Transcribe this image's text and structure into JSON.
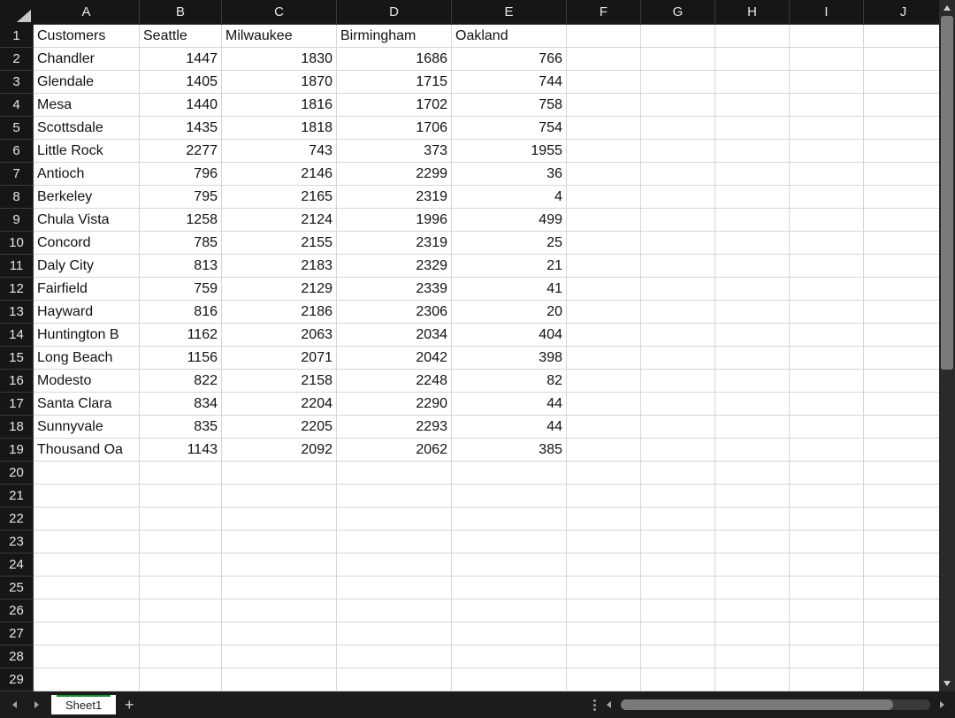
{
  "columns": [
    {
      "letter": "A",
      "width": 120
    },
    {
      "letter": "B",
      "width": 93
    },
    {
      "letter": "C",
      "width": 130
    },
    {
      "letter": "D",
      "width": 130
    },
    {
      "letter": "E",
      "width": 130
    },
    {
      "letter": "F",
      "width": 84
    },
    {
      "letter": "G",
      "width": 84
    },
    {
      "letter": "H",
      "width": 84
    },
    {
      "letter": "I",
      "width": 84
    },
    {
      "letter": "J",
      "width": 90
    }
  ],
  "row_count": 29,
  "headers": [
    "Customers",
    "Seattle",
    "Milwaukee",
    "Birmingham",
    "Oakland"
  ],
  "rows": [
    {
      "label": "Chandler",
      "v": [
        1447,
        1830,
        1686,
        766
      ]
    },
    {
      "label": "Glendale",
      "v": [
        1405,
        1870,
        1715,
        744
      ]
    },
    {
      "label": "Mesa",
      "v": [
        1440,
        1816,
        1702,
        758
      ]
    },
    {
      "label": "Scottsdale",
      "v": [
        1435,
        1818,
        1706,
        754
      ]
    },
    {
      "label": "Little Rock",
      "v": [
        2277,
        743,
        373,
        1955
      ]
    },
    {
      "label": "Antioch",
      "v": [
        796,
        2146,
        2299,
        36
      ]
    },
    {
      "label": "Berkeley",
      "v": [
        795,
        2165,
        2319,
        4
      ]
    },
    {
      "label": "Chula Vista",
      "v": [
        1258,
        2124,
        1996,
        499
      ]
    },
    {
      "label": "Concord",
      "v": [
        785,
        2155,
        2319,
        25
      ]
    },
    {
      "label": "Daly City",
      "v": [
        813,
        2183,
        2329,
        21
      ]
    },
    {
      "label": "Fairfield",
      "v": [
        759,
        2129,
        2339,
        41
      ]
    },
    {
      "label": "Hayward",
      "v": [
        816,
        2186,
        2306,
        20
      ]
    },
    {
      "label": "Huntington B",
      "v": [
        1162,
        2063,
        2034,
        404
      ]
    },
    {
      "label": "Long Beach",
      "v": [
        1156,
        2071,
        2042,
        398
      ]
    },
    {
      "label": "Modesto",
      "v": [
        822,
        2158,
        2248,
        82
      ]
    },
    {
      "label": "Santa Clara",
      "v": [
        834,
        2204,
        2290,
        44
      ]
    },
    {
      "label": "Sunnyvale",
      "v": [
        835,
        2205,
        2293,
        44
      ]
    },
    {
      "label": "Thousand Oa",
      "v": [
        1143,
        2092,
        2062,
        385
      ]
    }
  ],
  "sheet_tab": "Sheet1"
}
